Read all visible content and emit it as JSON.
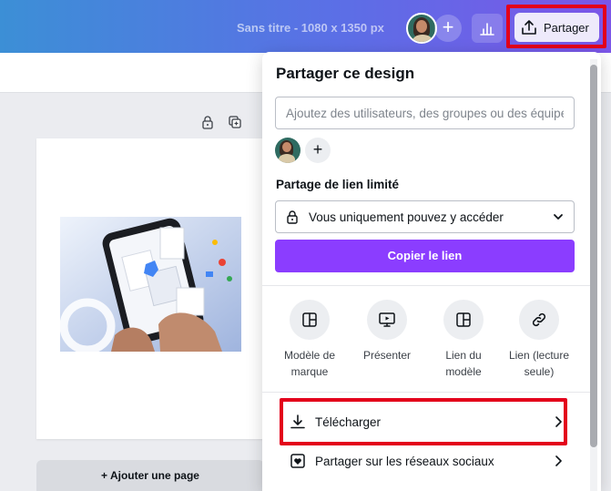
{
  "header": {
    "doc_title": "Sans titre - 1080 x 1350 px",
    "share_label": "Partager",
    "accent": "#8b3dff",
    "highlight": "#e3001b"
  },
  "canvas": {
    "add_page_label": "+ Ajouter une page"
  },
  "share_panel": {
    "title": "Partager ce design",
    "add_people_placeholder": "Ajoutez des utilisateurs, des groupes ou des équipes",
    "link_heading": "Partage de lien limité",
    "access_value": "Vous uniquement pouvez y accéder",
    "copy_link_label": "Copier le lien",
    "options": [
      {
        "icon": "template-icon",
        "label": "Modèle de marque"
      },
      {
        "icon": "present-icon",
        "label": "Présenter"
      },
      {
        "icon": "template-link-icon",
        "label": "Lien du modèle"
      },
      {
        "icon": "link-icon",
        "label": "Lien (lecture seule)"
      }
    ],
    "menu": [
      {
        "icon": "download-icon",
        "label": "Télécharger"
      },
      {
        "icon": "heart-icon",
        "label": "Partager sur les réseaux sociaux"
      }
    ]
  }
}
